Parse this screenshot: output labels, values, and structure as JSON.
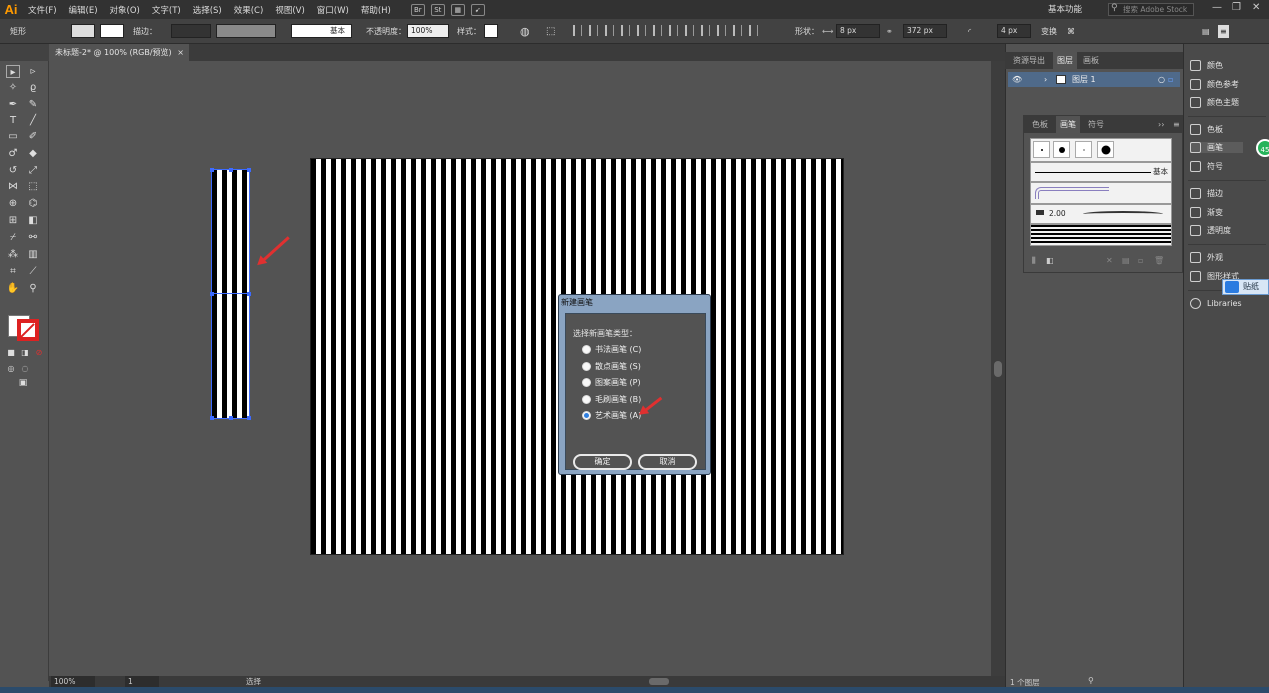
{
  "app": {
    "logo": "Ai"
  },
  "menu": [
    "文件(F)",
    "编辑(E)",
    "对象(O)",
    "文字(T)",
    "选择(S)",
    "效果(C)",
    "视图(V)",
    "窗口(W)",
    "帮助(H)"
  ],
  "menu_icons": [
    "Br",
    "St"
  ],
  "workspace": "基本功能",
  "stock_search_placeholder": "搜索 Adobe Stock",
  "window_controls": [
    "—",
    "❐",
    "✕"
  ],
  "control_bar": {
    "tool_name": "矩形",
    "stroke_label": "描边：",
    "brush_name": "基本",
    "opacity_label": "不透明度：",
    "opacity_value": "100%",
    "style_label": "样式：",
    "shape_label": "形状：",
    "width_value": "8 px",
    "height_value": "372 px",
    "corner_value": "4 px",
    "transform_label": "变换"
  },
  "document_tab": {
    "title": "未标题-2* @ 100% (RGB/预览)",
    "close": "×"
  },
  "status": {
    "zoom": "100%",
    "page": "1",
    "tool": "选择",
    "layers_count": "1 个图层"
  },
  "dialog": {
    "title": "新建画笔",
    "prompt": "选择新画笔类型：",
    "options": [
      {
        "label": "书法画笔 (C)",
        "selected": false
      },
      {
        "label": "散点画笔 (S)",
        "selected": false
      },
      {
        "label": "图案画笔 (P)",
        "selected": false
      },
      {
        "label": "毛刷画笔 (B)",
        "selected": false
      },
      {
        "label": "艺术画笔 (A)",
        "selected": true
      }
    ],
    "ok": "确定",
    "cancel": "取消"
  },
  "panels": {
    "top_tabs": [
      "资源导出",
      "图层",
      "画板"
    ],
    "layer_name": "图层 1",
    "brush_tabs": [
      "色板",
      "画笔",
      "符号"
    ],
    "brush_basic_label": "基本",
    "brush_size_label": "2.00"
  },
  "dock": [
    "颜色",
    "颜色参考",
    "颜色主题",
    "色板",
    "画笔",
    "符号",
    "描边",
    "渐变",
    "透明度",
    "外观",
    "图形样式",
    "Libraries"
  ],
  "badges": {
    "green": "45",
    "blue_chip": "贴纸"
  },
  "colors": {
    "accent_red": "#e03030",
    "selection_blue": "#3d6bff",
    "radio_blue": "#2f7fe0"
  }
}
